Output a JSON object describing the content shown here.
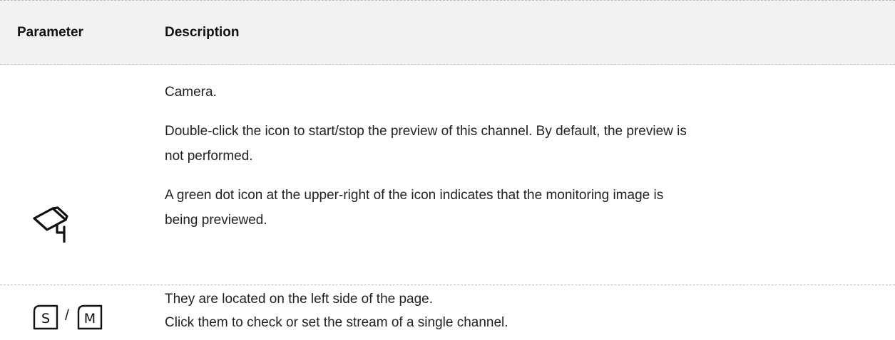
{
  "header": {
    "parameter": "Parameter",
    "description": "Description"
  },
  "rows": [
    {
      "icon": "camera-icon",
      "description_lines": [
        "Camera.",
        "Double-click the icon to start/stop the preview of this channel. By default, the preview is",
        "not performed.",
        "A green dot icon at the upper-right of the icon indicates that the monitoring image is",
        "being previewed."
      ]
    },
    {
      "icons": [
        "s-stream-icon",
        "m-stream-icon"
      ],
      "separator": "/",
      "description_lines": [
        "They are located on the left side of the page.",
        "Click them to check or set the stream of a single channel."
      ]
    }
  ]
}
